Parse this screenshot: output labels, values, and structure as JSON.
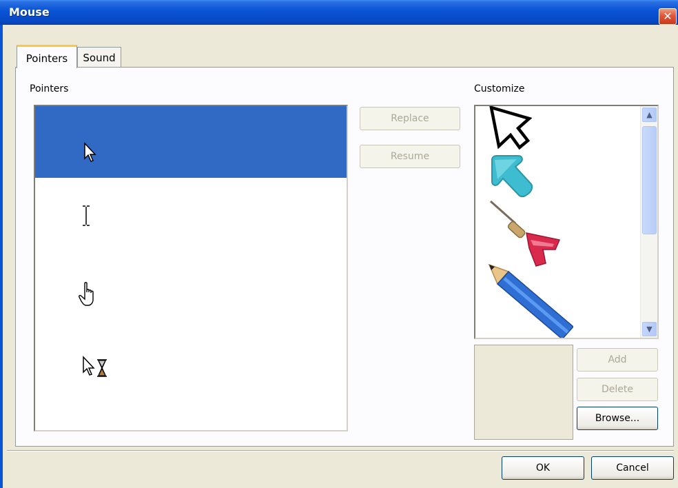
{
  "window": {
    "title": "Mouse",
    "close_glyph": "✕"
  },
  "tabs": [
    {
      "label": "Pointers",
      "active": true
    },
    {
      "label": "Sound",
      "active": false
    }
  ],
  "pointers_group": {
    "label": "Pointers",
    "items": [
      {
        "icon": "arrow-cursor-icon",
        "selected": true
      },
      {
        "icon": "text-select-cursor-icon",
        "selected": false
      },
      {
        "icon": "hand-cursor-icon",
        "selected": false
      },
      {
        "icon": "busy-cursor-icon",
        "selected": false
      }
    ]
  },
  "actions": {
    "replace_label": "Replace",
    "resume_label": "Resume"
  },
  "customize_group": {
    "label": "Customize",
    "items": [
      {
        "icon": "outline-arrow-cursor-icon"
      },
      {
        "icon": "teal-arrow-cursor-icon"
      },
      {
        "icon": "dart-cursor-icon"
      },
      {
        "icon": "pencil-cursor-icon"
      }
    ],
    "scroll_up_glyph": "▲",
    "scroll_down_glyph": "▼",
    "add_label": "Add",
    "delete_label": "Delete",
    "browse_label": "Browse..."
  },
  "footer": {
    "ok_label": "OK",
    "cancel_label": "Cancel"
  }
}
